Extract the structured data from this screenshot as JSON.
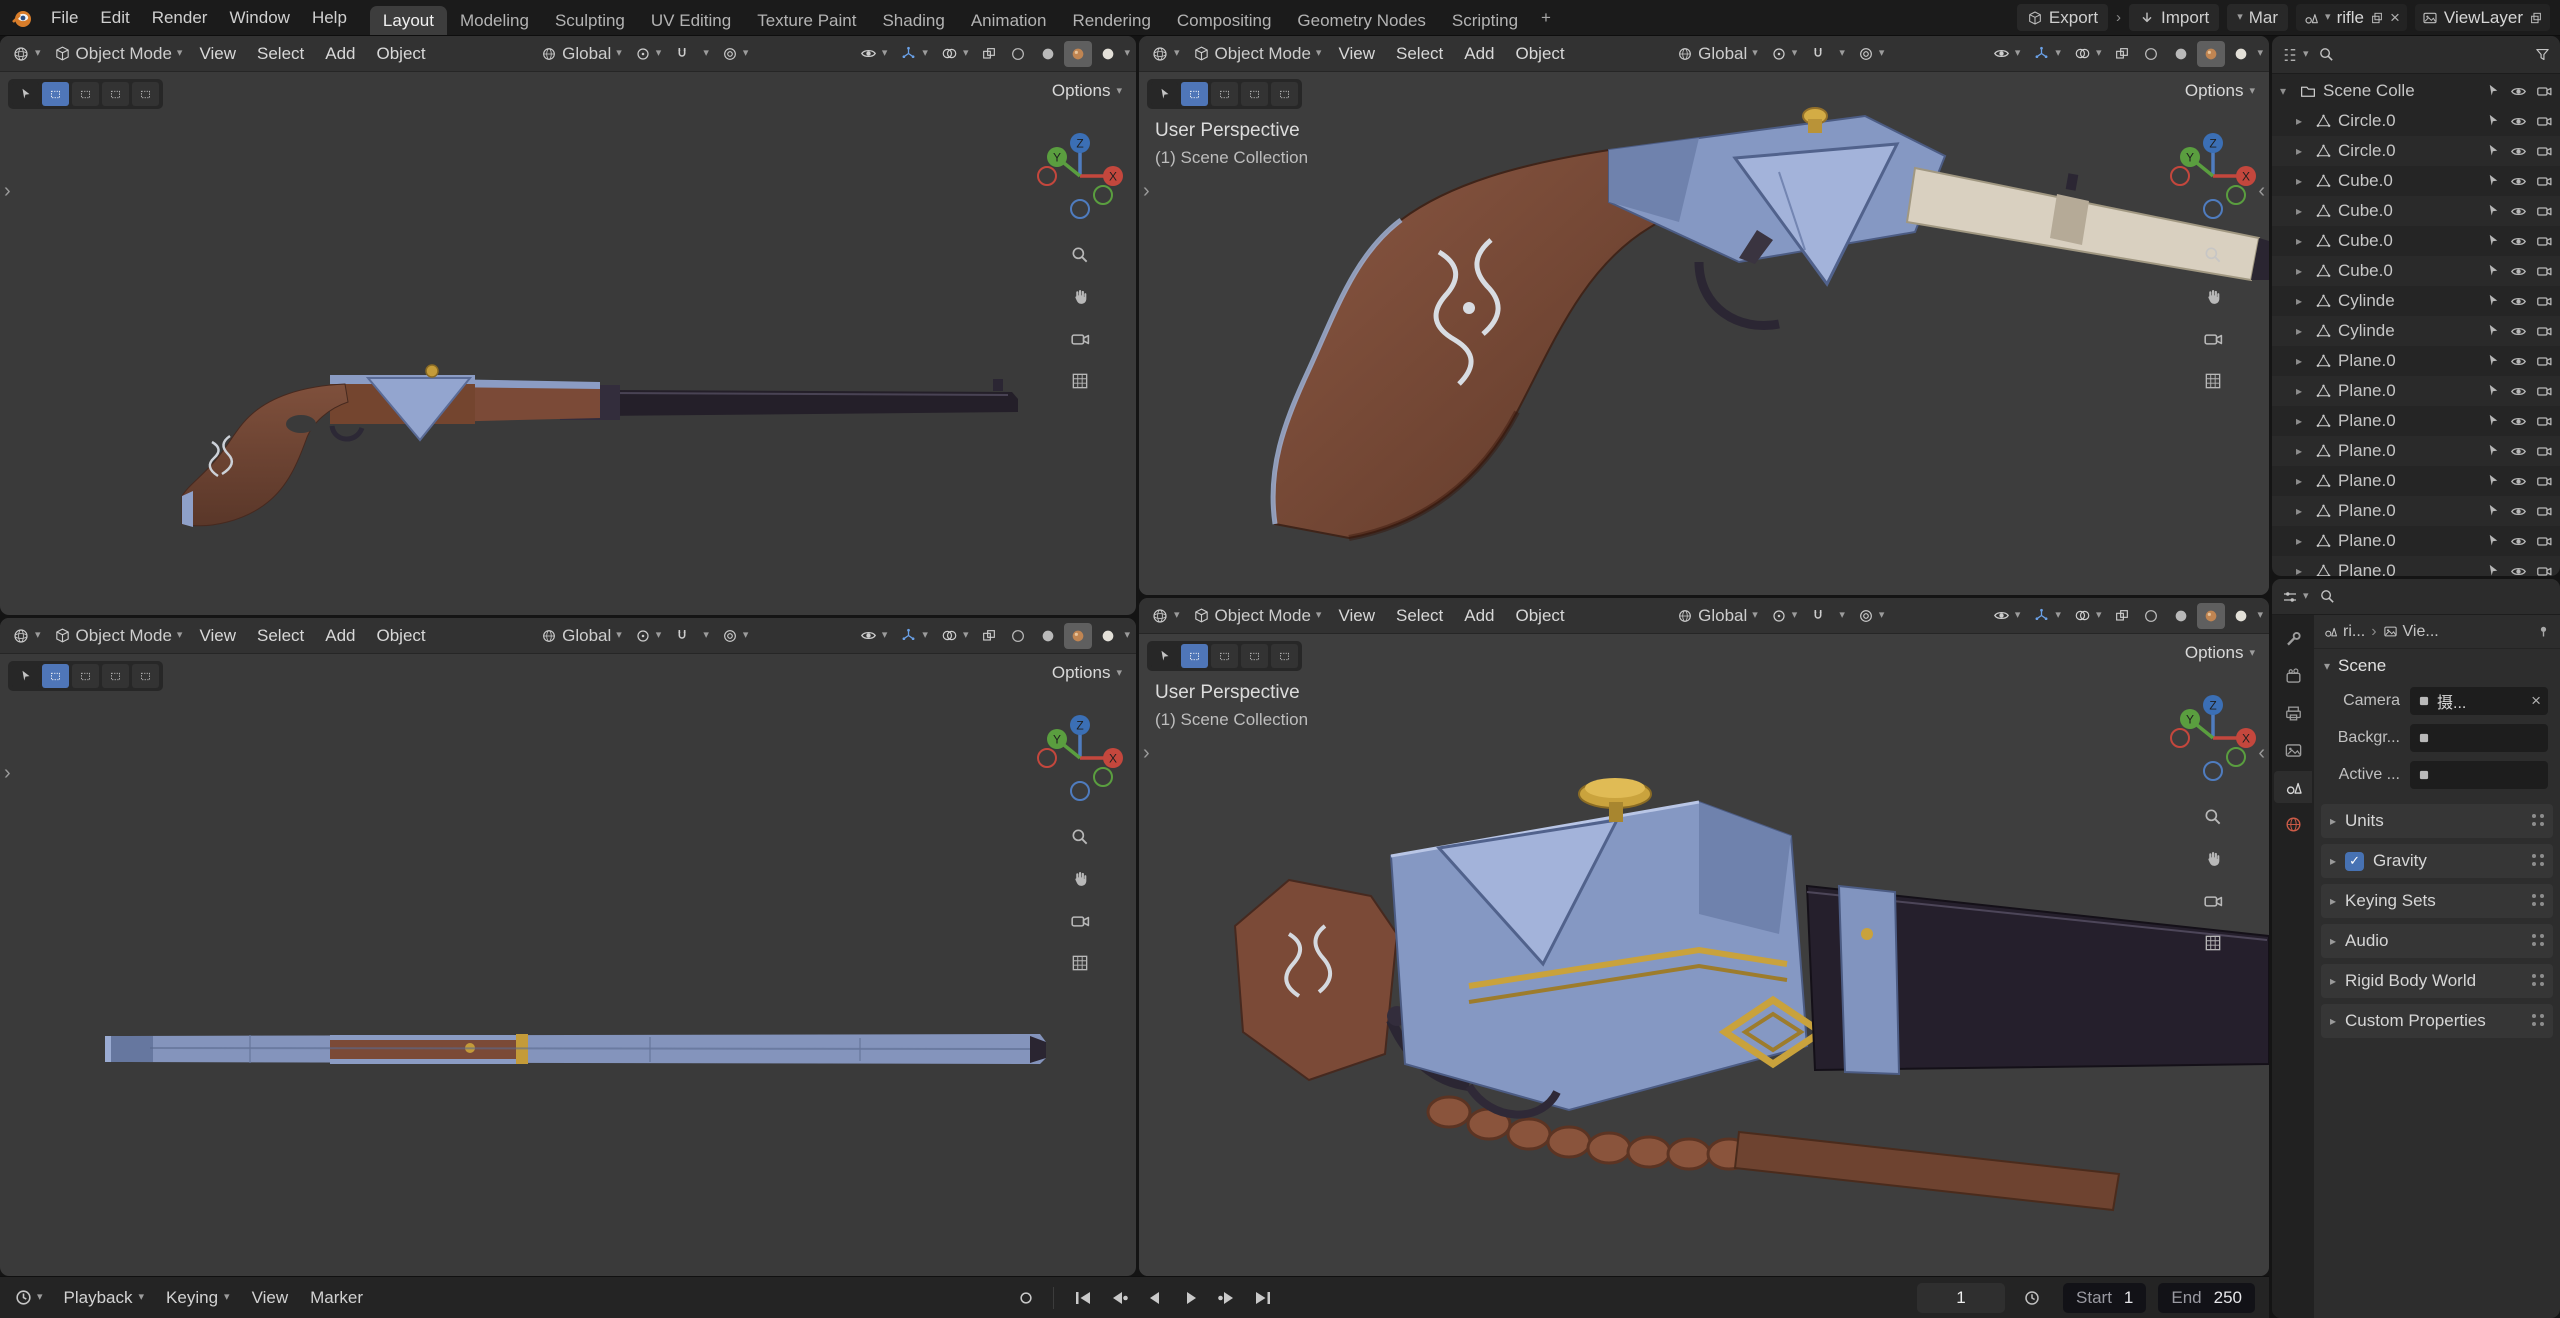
{
  "topbar": {
    "menus": [
      "File",
      "Edit",
      "Render",
      "Window",
      "Help"
    ],
    "workspaces": [
      {
        "label": "Layout",
        "active": true
      },
      {
        "label": "Modeling"
      },
      {
        "label": "Sculpting"
      },
      {
        "label": "UV Editing"
      },
      {
        "label": "Texture Paint"
      },
      {
        "label": "Shading"
      },
      {
        "label": "Animation"
      },
      {
        "label": "Rendering"
      },
      {
        "label": "Compositing"
      },
      {
        "label": "Geometry Nodes"
      },
      {
        "label": "Scripting"
      }
    ],
    "add_tab_label": "+",
    "export_label": "Export",
    "import_label": "Import",
    "truncated_button_label": "Mar",
    "scene_name": "rifle",
    "viewlayer_name": "ViewLayer"
  },
  "viewport": {
    "mode": "Object Mode",
    "menus": [
      "View",
      "Select",
      "Add",
      "Object"
    ],
    "orientation": "Global",
    "options_label": "Options",
    "overlay": {
      "perspective": "User Perspective",
      "collection": "(1) Scene Collection"
    }
  },
  "outliner": {
    "root_label": "Scene Colle",
    "items": [
      {
        "label": "Circle.0",
        "icon": "mesh-circle-icon"
      },
      {
        "label": "Circle.0",
        "icon": "mesh-circle-icon"
      },
      {
        "label": "Cube.0",
        "icon": "mesh-cube-icon"
      },
      {
        "label": "Cube.0",
        "icon": "mesh-cube-icon"
      },
      {
        "label": "Cube.0",
        "icon": "mesh-cube-icon"
      },
      {
        "label": "Cube.0",
        "icon": "mesh-cube-icon"
      },
      {
        "label": "Cylinde",
        "icon": "mesh-cylinder-icon"
      },
      {
        "label": "Cylinde",
        "icon": "mesh-cylinder-icon"
      },
      {
        "label": "Plane.0",
        "icon": "mesh-plane-icon"
      },
      {
        "label": "Plane.0",
        "icon": "mesh-plane-icon"
      },
      {
        "label": "Plane.0",
        "icon": "mesh-plane-icon"
      },
      {
        "label": "Plane.0",
        "icon": "mesh-plane-icon"
      },
      {
        "label": "Plane.0",
        "icon": "mesh-plane-icon"
      },
      {
        "label": "Plane.0",
        "icon": "mesh-plane-icon"
      },
      {
        "label": "Plane.0",
        "icon": "mesh-plane-icon"
      },
      {
        "label": "Plane.0",
        "icon": "mesh-plane-icon"
      }
    ]
  },
  "properties": {
    "breadcrumb": {
      "scene": "ri...",
      "viewlayer": "Vie..."
    },
    "panel_title": "Scene",
    "fields": [
      {
        "label": "Camera",
        "value": "摄...",
        "icon": "camera-data-icon",
        "cl": true
      },
      {
        "label": "Backgr...",
        "value": "",
        "icon": "background-scene-icon"
      },
      {
        "label": "Active ...",
        "value": "",
        "icon": "active-clip-icon"
      }
    ],
    "sections": [
      {
        "label": "Units"
      },
      {
        "label": "Gravity",
        "checkbox": true
      },
      {
        "label": "Keying Sets"
      },
      {
        "label": "Audio"
      },
      {
        "label": "Rigid Body World"
      },
      {
        "label": "Custom Properties"
      }
    ]
  },
  "timeline": {
    "menus": [
      {
        "label": "Playback",
        "dropdown": true
      },
      {
        "label": "Keying",
        "dropdown": true
      },
      {
        "label": "View"
      },
      {
        "label": "Marker"
      }
    ],
    "current_frame": "1",
    "start_label": "Start",
    "start_value": "1",
    "end_label": "End",
    "end_value": "250"
  },
  "colors": {
    "accent": "#4772b3",
    "axis_x": "#c4473d",
    "axis_y": "#5a9e3f",
    "axis_z": "#3b6fb5"
  }
}
